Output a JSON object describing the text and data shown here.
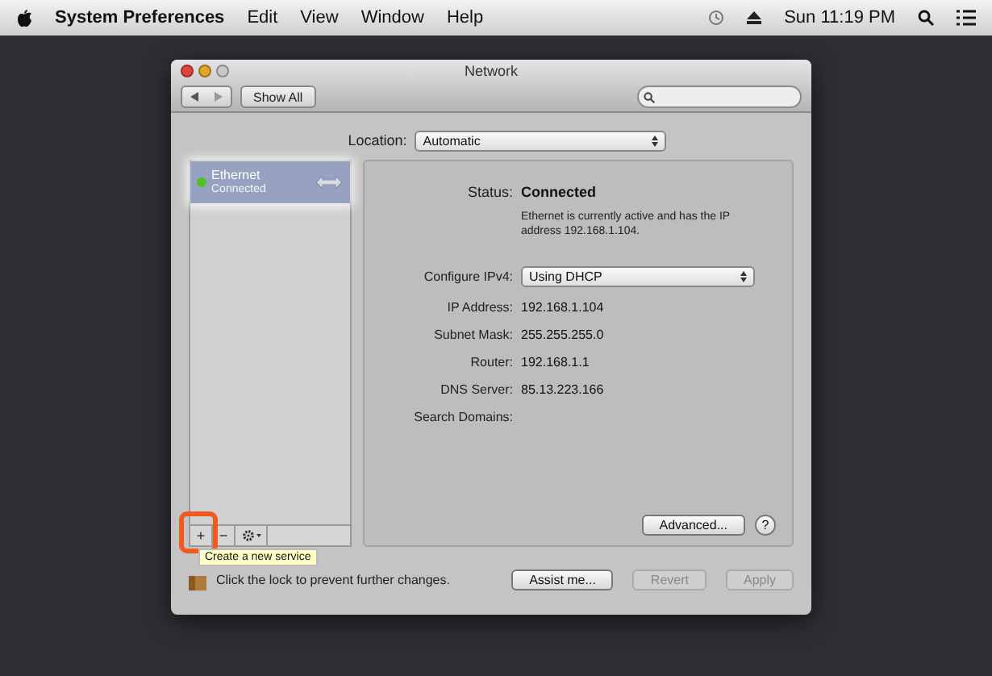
{
  "menu_bar": {
    "app": "System Preferences",
    "items": [
      "Edit",
      "View",
      "Window",
      "Help"
    ],
    "clock": "Sun 11:19 PM"
  },
  "window": {
    "title": "Network",
    "show_all": "Show All"
  },
  "location": {
    "label": "Location:",
    "value": "Automatic"
  },
  "services": [
    {
      "name": "Ethernet",
      "status": "Connected",
      "color": "#4fc22a",
      "selected": true
    }
  ],
  "service_tools": [
    {
      "label": "+",
      "highlighted": true
    },
    {
      "label": "−",
      "highlighted": false
    }
  ],
  "tooltip": "Create a new service",
  "details": {
    "status_label": "Status:",
    "status_value": "Connected",
    "status_note": "Ethernet is currently active and has the IP address 192.168.1.104.",
    "configure_label": "Configure IPv4:",
    "configure_value": "Using DHCP",
    "fields": [
      {
        "label": "IP Address:",
        "value": "192.168.1.104"
      },
      {
        "label": "Subnet Mask:",
        "value": "255.255.255.0"
      },
      {
        "label": "Router:",
        "value": "192.168.1.1"
      },
      {
        "label": "DNS Server:",
        "value": "85.13.223.166"
      },
      {
        "label": "Search Domains:"
      }
    ],
    "advanced": "Advanced...",
    "help": "?"
  },
  "footer": {
    "lock_text": "Click the lock to prevent further changes.",
    "buttons": [
      {
        "label": "Assist me...",
        "disabled": false
      },
      {
        "label": "Revert",
        "disabled": true
      },
      {
        "label": "Apply",
        "disabled": true
      }
    ]
  }
}
